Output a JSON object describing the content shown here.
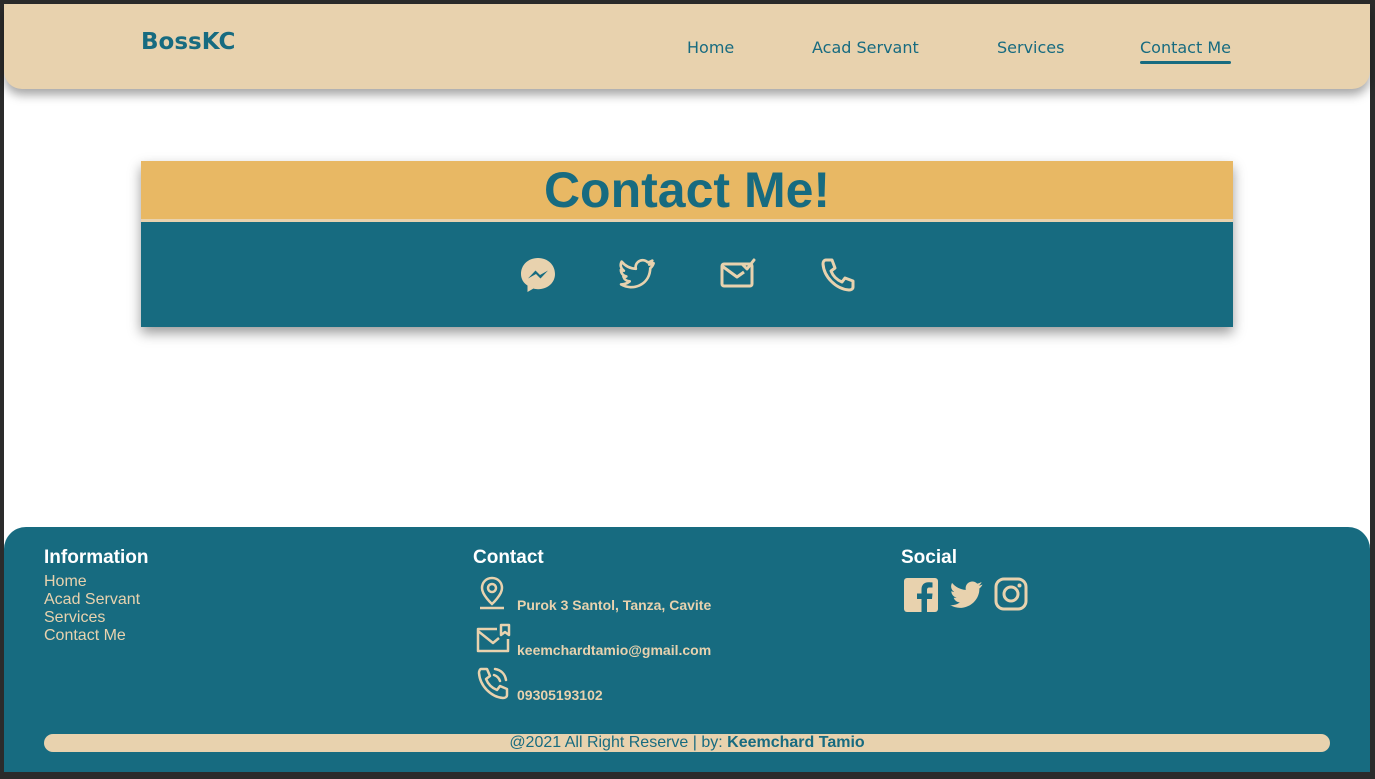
{
  "header": {
    "brand": "BossKC",
    "nav": [
      "Home",
      "Acad Servant",
      "Services",
      "Contact Me"
    ],
    "active": "Contact Me"
  },
  "contact_card": {
    "title": "Contact Me!",
    "icons": [
      "messenger-icon",
      "twitter-icon",
      "mail-check-icon",
      "phone-icon"
    ]
  },
  "footer": {
    "information": {
      "heading": "Information",
      "links": [
        "Home",
        "Acad Servant",
        "Services",
        "Contact Me"
      ]
    },
    "contact": {
      "heading": "Contact",
      "address": "Purok 3 Santol, Tanza, Cavite",
      "email": "keemchardtamio@gmail.com",
      "phone": "09305193102"
    },
    "social": {
      "heading": "Social",
      "icons": [
        "facebook-icon",
        "twitter-icon",
        "instagram-icon"
      ]
    },
    "copyright": {
      "text": "@2021 All Right Reserve | by: ",
      "author": "Keemchard Tamio"
    }
  },
  "colors": {
    "primary": "#176b80",
    "cream": "#e8d2ae",
    "gold": "#e8b864"
  }
}
